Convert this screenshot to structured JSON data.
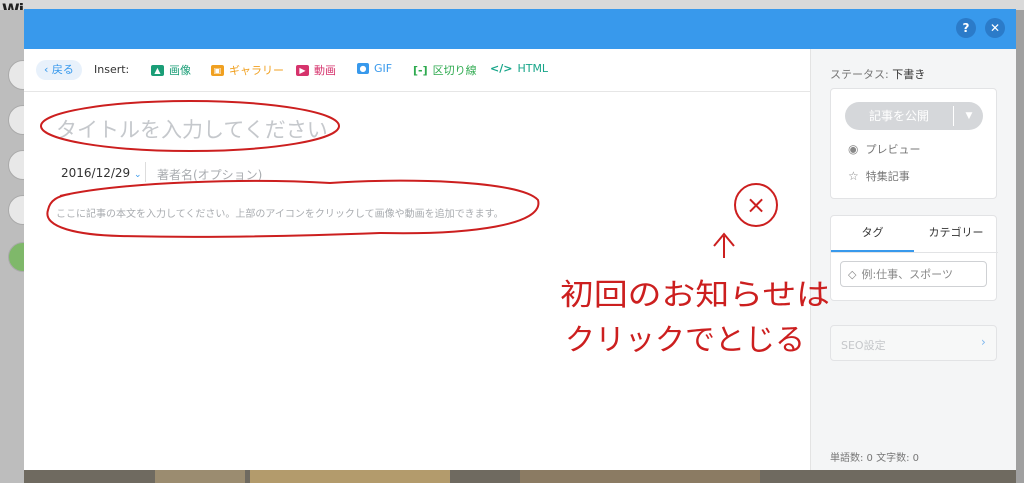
{
  "background": {
    "logo": "Wi"
  },
  "header": {
    "help_icon": "?",
    "close_icon": "✕"
  },
  "toolbar": {
    "back_label": "戻る",
    "insert_label": "Insert:",
    "items": [
      {
        "label": "画像",
        "icon": "image-icon",
        "color": "#1b9e77"
      },
      {
        "label": "ギャラリー",
        "icon": "gallery-icon",
        "color": "#f0a020"
      },
      {
        "label": "動画",
        "icon": "video-icon",
        "color": "#d6336c"
      },
      {
        "label": "GIF",
        "icon": "gif-icon",
        "color": "#3899ec"
      },
      {
        "label": "区切り線",
        "icon": "divider-icon",
        "color": "#2eaa4f"
      },
      {
        "label": "HTML",
        "icon": "code-icon",
        "color": "#17a589"
      }
    ]
  },
  "editor": {
    "title_placeholder": "タイトルを入力してください",
    "date": "2016/12/29",
    "author_placeholder": "著者名(オプション)",
    "body_placeholder": "ここに記事の本文を入力してください。上部のアイコンをクリックして画像や動画を追加できます。"
  },
  "sidebar": {
    "status_label": "ステータス:",
    "status_value": "下書き",
    "publish_label": "記事を公開",
    "preview_label": "プレビュー",
    "featured_label": "特集記事",
    "tab_tags": "タグ",
    "tab_categories": "カテゴリー",
    "tag_placeholder": "例:仕事、スポーツ",
    "seo_label": "SEO設定",
    "counts": "単語数: 0  文字数: 0"
  },
  "annotation": {
    "line1": "初回のお知らせは",
    "line2": "クリックでとじる",
    "mark": "×",
    "color": "#cc1f1f"
  }
}
